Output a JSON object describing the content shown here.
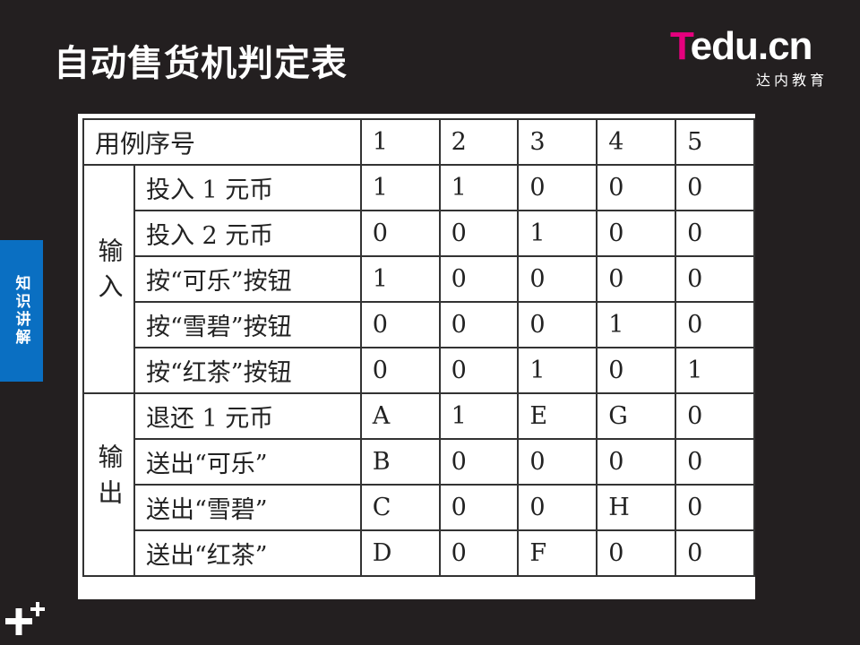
{
  "slide": {
    "title": "自动售货机判定表",
    "side_tab": "知识讲解"
  },
  "logo": {
    "word_t": "T",
    "word_rest": "edu.cn",
    "subtitle": "达内教育"
  },
  "table": {
    "header_label": "用例序号",
    "case_numbers": [
      "1",
      "2",
      "3",
      "4",
      "5"
    ],
    "input_group": "输入",
    "output_group": "输出",
    "inputs": [
      {
        "label": "投入 1 元币",
        "values": [
          "1",
          "1",
          "0",
          "0",
          "0"
        ]
      },
      {
        "label": "投入 2 元币",
        "values": [
          "0",
          "0",
          "1",
          "0",
          "0"
        ]
      },
      {
        "label": "按“可乐”按钮",
        "values": [
          "1",
          "0",
          "0",
          "0",
          "0"
        ]
      },
      {
        "label": "按“雪碧”按钮",
        "values": [
          "0",
          "0",
          "0",
          "1",
          "0"
        ]
      },
      {
        "label": "按“红茶”按钮",
        "values": [
          "0",
          "0",
          "1",
          "0",
          "1"
        ]
      }
    ],
    "outputs": [
      {
        "label": "退还 1 元币",
        "values": [
          "A",
          "1",
          "E",
          "G",
          "0"
        ]
      },
      {
        "label": "送出“可乐”",
        "values": [
          "B",
          "0",
          "0",
          "0",
          "0"
        ]
      },
      {
        "label": "送出“雪碧”",
        "values": [
          "C",
          "0",
          "0",
          "H",
          "0"
        ]
      },
      {
        "label": "送出“红茶”",
        "values": [
          "D",
          "0",
          "F",
          "0",
          "0"
        ]
      }
    ]
  }
}
